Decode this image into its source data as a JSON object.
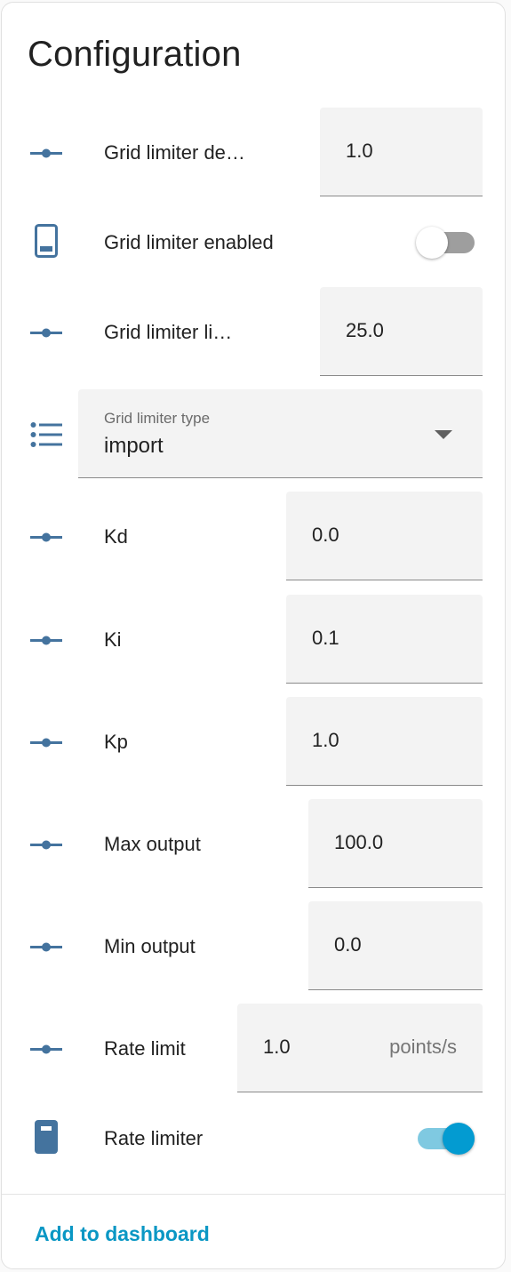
{
  "card": {
    "title": "Configuration",
    "footer_link": "Add to dashboard"
  },
  "colors": {
    "icon": "#44739e",
    "accent": "#039bd1",
    "toggle_track_on": "#7fc9e1",
    "toggle_track_off": "#9e9e9e"
  },
  "rows": {
    "grid_limiter_deadband": {
      "label": "Grid limiter de…",
      "value": "1.0",
      "icon": "slider-icon"
    },
    "grid_limiter_enabled": {
      "label": "Grid limiter enabled",
      "icon": "device-icon",
      "state": "off"
    },
    "grid_limiter_limit": {
      "label": "Grid limiter li…",
      "value": "25.0",
      "icon": "slider-icon"
    },
    "grid_limiter_type": {
      "label": "Grid limiter type",
      "value": "import",
      "icon": "list-icon"
    },
    "kd": {
      "label": "Kd",
      "value": "0.0",
      "icon": "slider-icon"
    },
    "ki": {
      "label": "Ki",
      "value": "0.1",
      "icon": "slider-icon"
    },
    "kp": {
      "label": "Kp",
      "value": "1.0",
      "icon": "slider-icon"
    },
    "max_output": {
      "label": "Max output",
      "value": "100.0",
      "icon": "slider-icon"
    },
    "min_output": {
      "label": "Min output",
      "value": "0.0",
      "icon": "slider-icon"
    },
    "rate_limit": {
      "label": "Rate limit",
      "value": "1.0",
      "unit": "points/s",
      "icon": "slider-icon"
    },
    "rate_limiter": {
      "label": "Rate limiter",
      "icon": "device-icon",
      "state": "on"
    }
  }
}
